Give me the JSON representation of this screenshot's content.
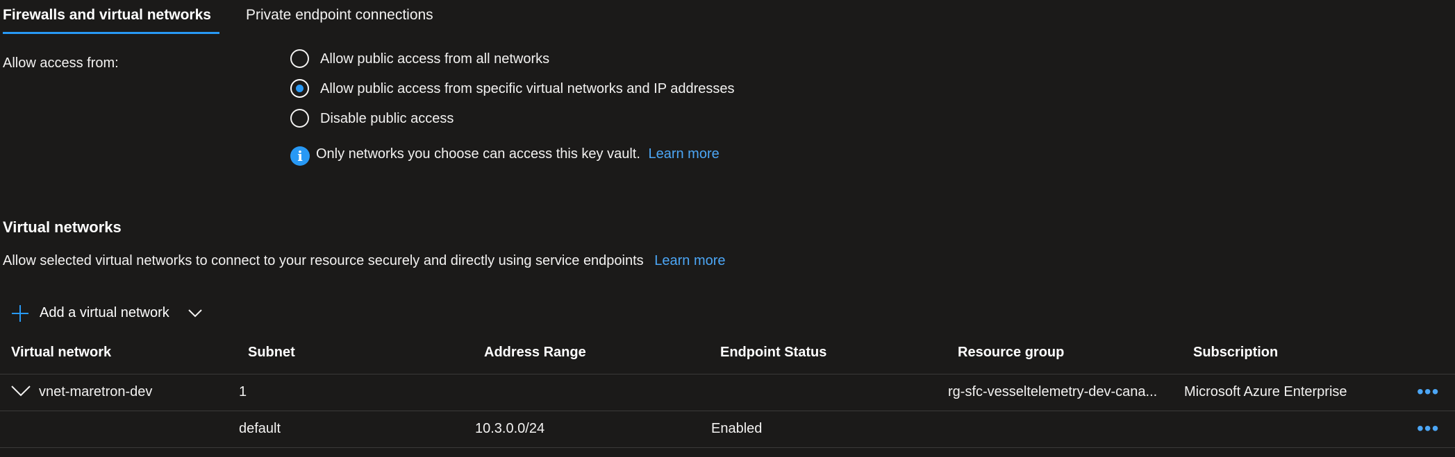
{
  "tabs": {
    "active_label": "Firewalls and virtual networks",
    "inactive_label": "Private endpoint connections"
  },
  "access": {
    "label": "Allow access from:",
    "options": [
      {
        "label": "Allow public access from all networks",
        "checked": false
      },
      {
        "label": "Allow public access from specific virtual networks and IP addresses",
        "checked": true
      },
      {
        "label": "Disable public access",
        "checked": false
      }
    ],
    "info_text": "Only networks you choose can access this key vault.",
    "info_link": "Learn more"
  },
  "virtual_networks": {
    "title": "Virtual networks",
    "description": "Allow selected virtual networks to connect to your resource securely and directly using service endpoints",
    "description_link": "Learn more",
    "add_button_label": "Add a virtual network"
  },
  "table": {
    "columns": [
      "Virtual network",
      "Subnet",
      "Address Range",
      "Endpoint Status",
      "Resource group",
      "Subscription"
    ],
    "rows": [
      {
        "virtual_network": "vnet-maretron-dev",
        "subnet": "1",
        "address_range": "",
        "endpoint_status": "",
        "resource_group": "rg-sfc-vesseltelemetry-dev-cana...",
        "subscription": "Microsoft Azure Enterprise",
        "more": "•••"
      },
      {
        "virtual_network": "",
        "subnet": "default",
        "address_range": "10.3.0.0/24",
        "endpoint_status": "Enabled",
        "resource_group": "",
        "subscription": "",
        "more": "•••"
      }
    ]
  },
  "colors": {
    "background": "#1b1a19",
    "accent": "#2899f5",
    "link": "#4ca6f5"
  }
}
